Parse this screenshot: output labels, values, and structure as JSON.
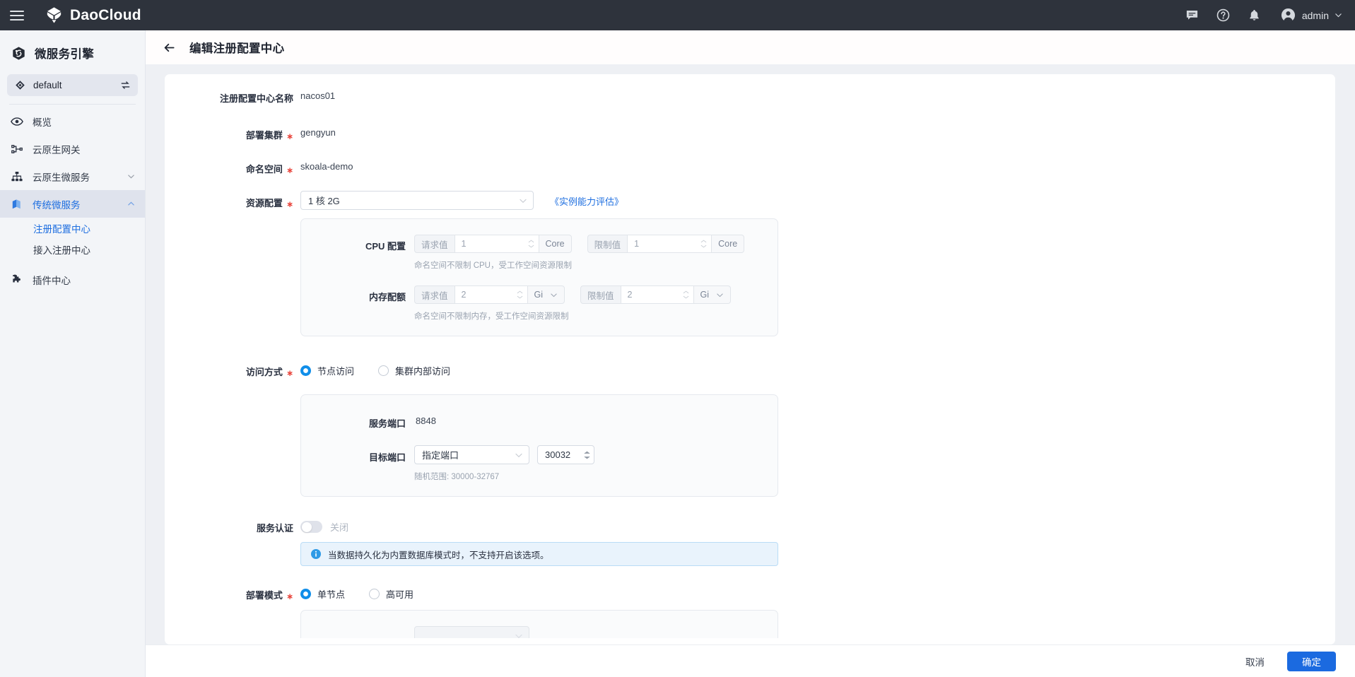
{
  "topbar": {
    "menu_icon": "hamburger-icon",
    "brand": "DaoCloud",
    "icons": [
      "message-icon",
      "help-icon",
      "bell-icon"
    ],
    "user": "admin"
  },
  "sidebar": {
    "product_title": "微服务引擎",
    "workspace": {
      "label": "default",
      "swap_icon": "swap-icon"
    },
    "items": [
      {
        "label": "概览",
        "icon": "eye-icon",
        "active": false,
        "expandable": false
      },
      {
        "label": "云原生网关",
        "icon": "gateway-icon",
        "active": false,
        "expandable": false
      },
      {
        "label": "云原生微服务",
        "icon": "hierarchy-icon",
        "active": false,
        "expandable": true,
        "expanded": false
      },
      {
        "label": "传统微服务",
        "icon": "cube-icon",
        "active": true,
        "expandable": true,
        "expanded": true
      },
      {
        "label": "插件中心",
        "icon": "puzzle-icon",
        "active": false,
        "expandable": false
      }
    ],
    "sub_items": [
      {
        "label": "注册配置中心",
        "current": true
      },
      {
        "label": "接入注册中心",
        "current": false
      }
    ]
  },
  "page": {
    "back_icon": "arrow-left-icon",
    "title": "编辑注册配置中心"
  },
  "form": {
    "name": {
      "label": "注册配置中心名称",
      "value": "nacos01",
      "required": false
    },
    "cluster": {
      "label": "部署集群",
      "value": "gengyun",
      "required": true
    },
    "namespace": {
      "label": "命名空间",
      "value": "skoala-demo",
      "required": true
    },
    "resource": {
      "label": "资源配置",
      "required": true,
      "selected": "1 核 2G",
      "link_text": "《实例能力评估》"
    },
    "cpu": {
      "label": "CPU 配置",
      "request_tag": "请求值",
      "request_value": "1",
      "request_unit": "Core",
      "limit_tag": "限制值",
      "limit_value": "1",
      "limit_unit": "Core",
      "hint": "命名空间不限制 CPU，受工作空间资源限制"
    },
    "memory": {
      "label": "内存配额",
      "request_tag": "请求值",
      "request_value": "2",
      "request_unit": "Gi",
      "limit_tag": "限制值",
      "limit_value": "2",
      "limit_unit": "Gi",
      "hint": "命名空间不限制内存，受工作空间资源限制"
    },
    "access": {
      "label": "访问方式",
      "required": true,
      "options": [
        {
          "label": "节点访问",
          "selected": true
        },
        {
          "label": "集群内部访问",
          "selected": false
        }
      ]
    },
    "service_port": {
      "label": "服务端口",
      "value": "8848"
    },
    "target_port": {
      "label": "目标端口",
      "mode": "指定端口",
      "value": "30032",
      "hint": "随机范围: 30000-32767"
    },
    "service_auth": {
      "label": "服务认证",
      "enabled": false,
      "state_text": "关闭"
    },
    "auth_alert": {
      "icon": "info-icon",
      "text": "当数据持久化为内置数据库模式时，不支持开启该选项。"
    },
    "deploy_mode": {
      "label": "部署模式",
      "required": true,
      "options": [
        {
          "label": "单节点",
          "selected": true
        },
        {
          "label": "高可用",
          "selected": false
        }
      ]
    },
    "cut_off_row": {
      "label": "",
      "value": ""
    }
  },
  "footer": {
    "cancel": "取消",
    "confirm": "确定"
  },
  "colors": {
    "brand_dark": "#2e333c",
    "accent_blue": "#1f6fe0",
    "primary_button": "#1b6ae0",
    "radio_blue": "#108ee9",
    "required_red": "#e8453c",
    "alert_bg": "#e9f3fc",
    "alert_border": "#b9dcf6",
    "sidebar_bg": "#f3f5f8",
    "page_bg": "#eef0f4"
  }
}
